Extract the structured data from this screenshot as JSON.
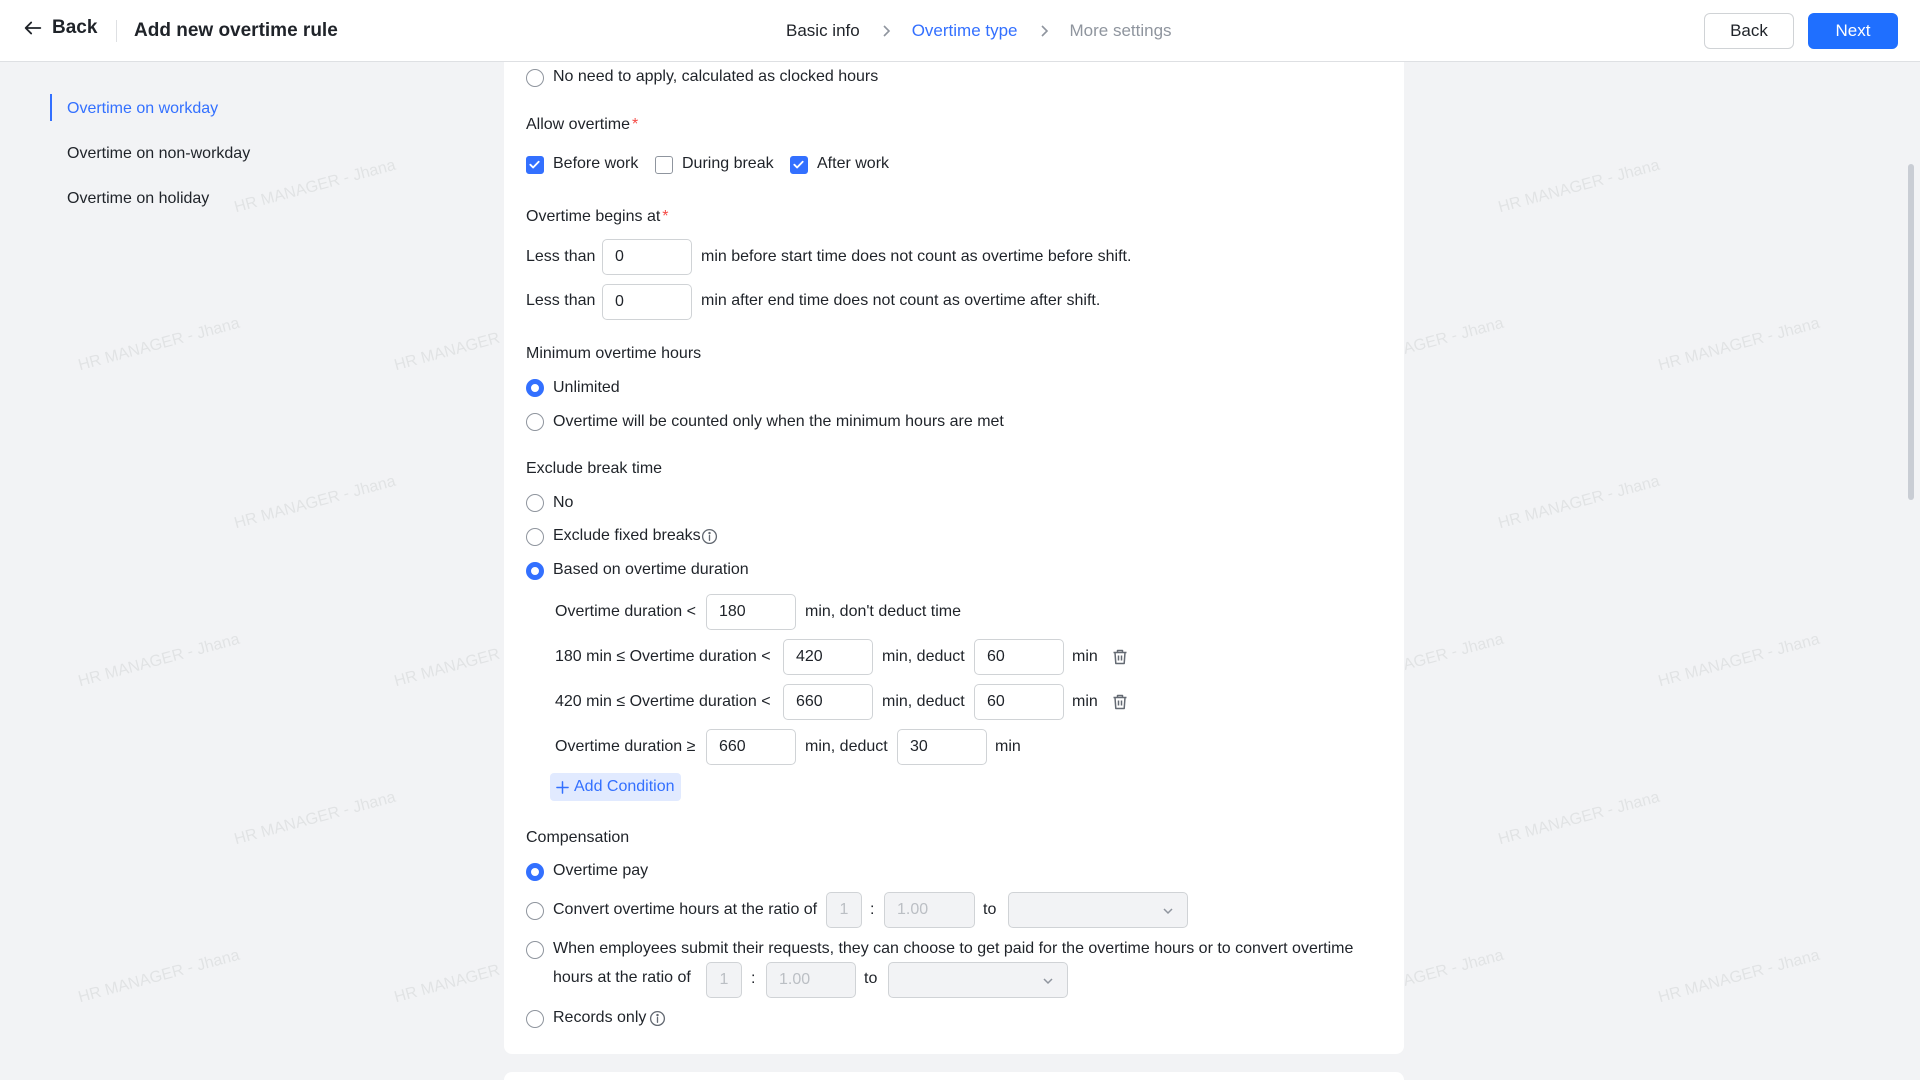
{
  "header": {
    "back_label": "Back",
    "title": "Add new overtime rule",
    "steps": [
      "Basic info",
      "Overtime type",
      "More settings"
    ],
    "active_step": 1,
    "btn_back": "Back",
    "btn_next": "Next"
  },
  "sidebar": {
    "items": [
      {
        "label": "Overtime on workday",
        "active": true
      },
      {
        "label": "Overtime on non-workday",
        "active": false
      },
      {
        "label": "Overtime on holiday",
        "active": false
      }
    ]
  },
  "form": {
    "no_apply_option": "No need to apply, calculated as clocked hours",
    "allow_overtime": {
      "label": "Allow overtime",
      "required_mark": "*",
      "options": [
        {
          "label": "Before work",
          "checked": true
        },
        {
          "label": "During break",
          "checked": false
        },
        {
          "label": "After work",
          "checked": true
        }
      ]
    },
    "begins_at": {
      "label": "Overtime begins at",
      "required_mark": "*",
      "row1": {
        "prefix": "Less than",
        "value": "0",
        "suffix": "min before start time does not count as overtime before shift."
      },
      "row2": {
        "prefix": "Less than",
        "value": "0",
        "suffix": "min after end time does not count as overtime after shift."
      }
    },
    "minimum_hours": {
      "label": "Minimum overtime hours",
      "options": [
        {
          "label": "Unlimited",
          "selected": true
        },
        {
          "label": "Overtime will be counted only when the minimum hours are met",
          "selected": false
        }
      ]
    },
    "exclude_break": {
      "label": "Exclude break time",
      "options": [
        {
          "label": "No",
          "selected": false
        },
        {
          "label": "Exclude fixed breaks",
          "selected": false
        },
        {
          "label": "Based on overtime duration",
          "selected": true
        }
      ],
      "rules": [
        {
          "prefix": "Overtime duration <",
          "value": "180",
          "mid": "min, don't deduct time"
        },
        {
          "prefix": "180 min ≤ Overtime duration <",
          "value": "420",
          "mid": "min, deduct",
          "deduct": "60",
          "unit": "min"
        },
        {
          "prefix": "420 min ≤ Overtime duration <",
          "value": "660",
          "mid": "min, deduct",
          "deduct": "60",
          "unit": "min"
        },
        {
          "prefix": "Overtime duration ≥",
          "value": "660",
          "mid": "min, deduct",
          "deduct": "30",
          "unit": "min"
        }
      ],
      "add_condition": "Add Condition"
    },
    "compensation": {
      "label": "Compensation",
      "overtime_pay": "Overtime pay",
      "convert_label": "Convert overtime hours at the ratio of",
      "convert_left": "1",
      "convert_colon": ":",
      "convert_right": "1.00",
      "convert_to": "to",
      "choose_label_line1": "When employees submit their requests, they can choose to get paid for the overtime hours or to convert overtime",
      "choose_label_line2": "hours at the ratio of",
      "choose_left": "1",
      "choose_colon": ":",
      "choose_right": "1.00",
      "choose_to": "to",
      "records_only": "Records only",
      "selected": "overtime_pay"
    }
  },
  "watermark": "HR MANAGER - Jhana",
  "colors": {
    "accent": "#3370ff",
    "primary_button": "#1f6fff",
    "required": "#f54a45"
  }
}
